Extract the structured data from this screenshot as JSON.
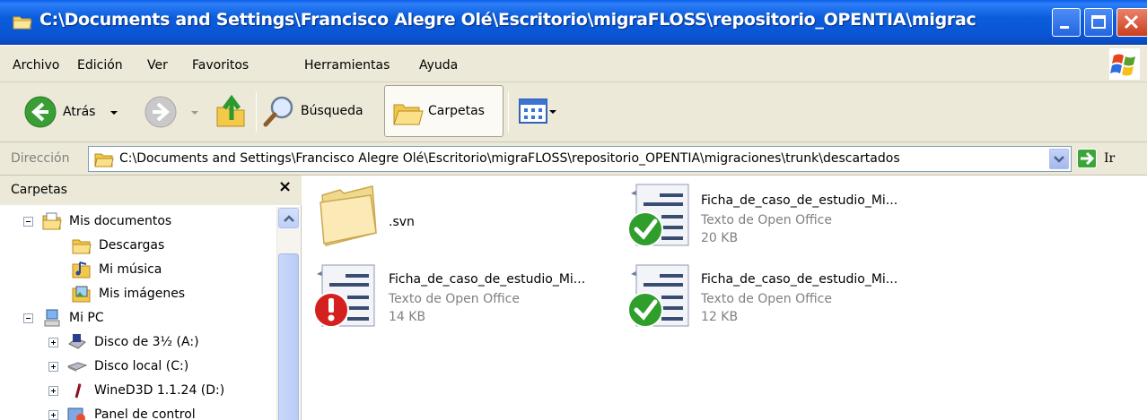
{
  "window": {
    "title": "C:\\Documents and Settings\\Francisco Alegre Olé\\Escritorio\\migraFLOSS\\repositorio_OPENTIA\\migrac"
  },
  "menu": [
    "Archivo",
    "Edición",
    "Ver",
    "Favoritos",
    "Herramientas",
    "Ayuda"
  ],
  "toolbar": {
    "back_label": "Atrás",
    "search_label": "Búsqueda",
    "folders_label": "Carpetas"
  },
  "address": {
    "label": "Dirección",
    "value": "C:\\Documents and Settings\\Francisco Alegre Olé\\Escritorio\\migraFLOSS\\repositorio_OPENTIA\\migraciones\\trunk\\descartados",
    "go_label": "Ir"
  },
  "folders_panel": {
    "title": "Carpetas",
    "close_label": "×",
    "tree": [
      {
        "label": "Mis documentos",
        "expander": "minus",
        "icon": "my-documents-icon"
      },
      {
        "label": "Descargas",
        "expander": "",
        "icon": "folder-icon"
      },
      {
        "label": "Mi música",
        "expander": "",
        "icon": "my-music-icon"
      },
      {
        "label": "Mis imágenes",
        "expander": "",
        "icon": "my-pictures-icon"
      },
      {
        "label": "Mi PC",
        "expander": "minus",
        "icon": "my-computer-icon"
      },
      {
        "label": "Disco de 3½ (A:)",
        "expander": "plus",
        "icon": "floppy-drive-icon"
      },
      {
        "label": "Disco local (C:)",
        "expander": "plus",
        "icon": "local-disk-icon"
      },
      {
        "label": "WineD3D 1.1.24 (D:)",
        "expander": "plus",
        "icon": "wine-drive-icon"
      },
      {
        "label": "Panel de control",
        "expander": "plus",
        "icon": "control-panel-icon"
      }
    ]
  },
  "files": [
    {
      "name": ".svn",
      "type": "",
      "size": "",
      "icon": "folder-icon"
    },
    {
      "name": "Ficha_de_caso_de_estudio_Mi...",
      "type": "Texto de Open Office",
      "size": "20 KB",
      "icon": "odt-check-icon"
    },
    {
      "name": "Ficha_de_caso_de_estudio_Mi...",
      "type": "Texto de Open Office",
      "size": "14 KB",
      "icon": "odt-error-icon"
    },
    {
      "name": "Ficha_de_caso_de_estudio_Mi...",
      "type": "Texto de Open Office",
      "size": "12 KB",
      "icon": "odt-check-icon"
    }
  ],
  "colors": {
    "title_bar": "#0a5ee8",
    "chrome": "#ece9d8",
    "muted_text": "#808080",
    "check_green": "#2f9e2a",
    "error_red": "#d52020"
  }
}
